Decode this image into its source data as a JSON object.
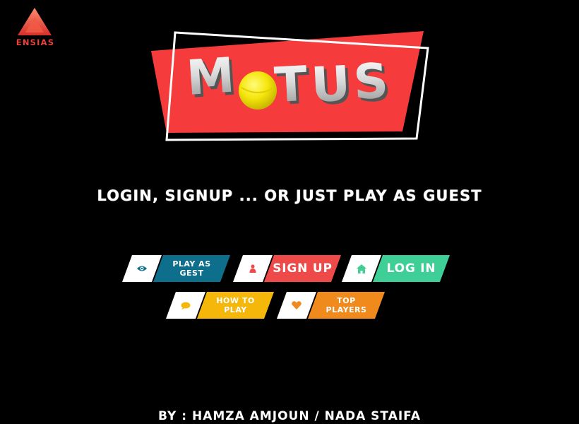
{
  "brand": {
    "school_name": "ENSIAS",
    "school_color": "#e8413b",
    "game_title": "MOTUS",
    "title_banner_color": "#f53b3b",
    "ball_color": "#f5e60c"
  },
  "tagline": "LOGIN, SIGNUP ... OR JUST PLAY AS GUEST",
  "menu": {
    "play_as_guest": {
      "label": "PLAY AS GEST",
      "icon": "eye-icon",
      "color": "#0e6f8c"
    },
    "sign_up": {
      "label": "SIGN UP",
      "icon": "user-icon",
      "color": "#ef4a4a"
    },
    "log_in": {
      "label": "LOG IN",
      "icon": "home-icon",
      "color": "#3ecf97"
    },
    "how_to_play": {
      "label": "HOW TO PLAY",
      "icon": "speech-bubble-icon",
      "color": "#f5b70a"
    },
    "top_players": {
      "label": "TOP PLAYERS",
      "icon": "heart-icon",
      "color": "#f08a1c"
    }
  },
  "credits": "BY : HAMZA AMJOUN / NADA STAIFA"
}
